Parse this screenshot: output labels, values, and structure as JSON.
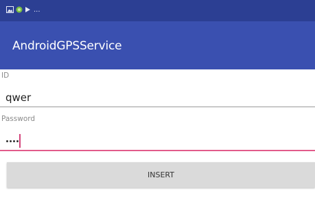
{
  "status_bar": {
    "icons": [
      "image-icon",
      "android-icon",
      "play-icon"
    ],
    "overflow": "..."
  },
  "app_bar": {
    "title": "AndroidGPSService"
  },
  "form": {
    "id_label": "ID",
    "id_value": "qwer",
    "password_label": "Password",
    "password_masked_length": 4
  },
  "actions": {
    "insert_label": "INSERT"
  },
  "colors": {
    "status_bar": "#2c3f93",
    "app_bar": "#3a50b0",
    "accent": "#e25b8a",
    "button_bg": "#dadada"
  }
}
